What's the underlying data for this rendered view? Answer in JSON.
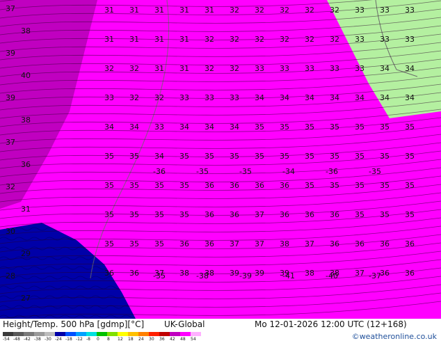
{
  "footer": {
    "title": "Height/Temp. 500 hPa [gdmp][°C]",
    "model": "UK-Global",
    "valid": "Mo 12-01-2026 12:00 UTC (12+168)",
    "credit": "©weatheronline.co.uk"
  },
  "legend": {
    "ticks": [
      "-54",
      "-48",
      "-42",
      "-38",
      "-30",
      "-24",
      "-18",
      "-12",
      "-8",
      "0",
      "8",
      "12",
      "18",
      "24",
      "30",
      "36",
      "42",
      "48",
      "54"
    ],
    "colors": [
      "#3a3a3a",
      "#5a5a5a",
      "#7a7a7a",
      "#9a9a9a",
      "#bcbcbc",
      "#0000a8",
      "#0050ff",
      "#00a0ff",
      "#00e0e0",
      "#00c000",
      "#80e000",
      "#ffff00",
      "#ffc000",
      "#ff8000",
      "#ff2000",
      "#c00000",
      "#c000c0",
      "#ff00ff",
      "#ffb0ff"
    ]
  },
  "map": {
    "colors": {
      "land": "#b4f0a0",
      "dark_magenta": "#c000c0",
      "magenta": "#ff00ff",
      "blue": "#0000a8",
      "coast": "#6a6a6a",
      "label": "#111111"
    },
    "rows": [
      [
        "31",
        "31",
        "31",
        "31",
        "31",
        "32",
        "32",
        "32",
        "32",
        "32",
        "33",
        "33",
        "33"
      ],
      [
        "31",
        "31",
        "31",
        "31",
        "32",
        "32",
        "32",
        "32",
        "32",
        "32",
        "33",
        "33",
        "33"
      ],
      [
        "32",
        "32",
        "31",
        "31",
        "32",
        "32",
        "33",
        "33",
        "33",
        "33",
        "33",
        "34",
        "34"
      ],
      [
        "33",
        "32",
        "32",
        "33",
        "33",
        "33",
        "34",
        "34",
        "34",
        "34",
        "34",
        "34",
        "34"
      ],
      [
        "34",
        "34",
        "33",
        "34",
        "34",
        "34",
        "35",
        "35",
        "35",
        "35",
        "35",
        "35",
        "35"
      ],
      [
        "35",
        "35",
        "34",
        "35",
        "35",
        "35",
        "35",
        "35",
        "35",
        "35",
        "35",
        "35",
        "35"
      ],
      [
        "35",
        "35",
        "35",
        "35",
        "36",
        "36",
        "36",
        "36",
        "35",
        "35",
        "35",
        "35",
        "35"
      ],
      [
        "35",
        "35",
        "35",
        "35",
        "36",
        "36",
        "37",
        "36",
        "36",
        "36",
        "35",
        "35",
        "35"
      ],
      [
        "35",
        "35",
        "35",
        "36",
        "36",
        "37",
        "37",
        "38",
        "37",
        "36",
        "36",
        "36",
        "36"
      ],
      [
        "36",
        "36",
        "37",
        "38",
        "38",
        "39",
        "39",
        "39",
        "38",
        "38",
        "37",
        "36",
        "36"
      ]
    ],
    "west_values": [
      "37",
      "38",
      "39",
      "40",
      "39",
      "38",
      "37",
      "36",
      "32",
      "31",
      "30",
      "29",
      "28",
      "27"
    ],
    "mid_labels": [
      "-36",
      "-35",
      "-35",
      "-34",
      "-36",
      "-35",
      "-35",
      "-38",
      "-39",
      "-41",
      "-40",
      "-37"
    ]
  }
}
